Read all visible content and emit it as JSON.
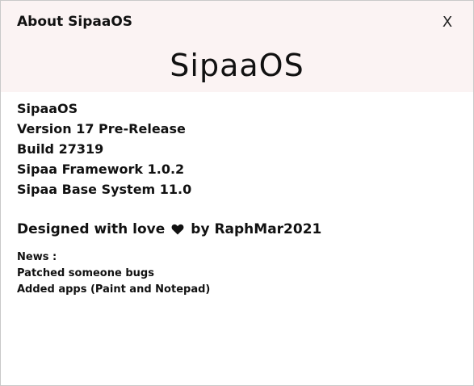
{
  "window": {
    "title": "About SipaaOS",
    "close_label": "X"
  },
  "brand": {
    "name": "SipaaOS"
  },
  "info": {
    "lines": [
      "SipaaOS",
      "Version 17 Pre-Release",
      "Build 27319",
      "Sipaa Framework 1.0.2",
      "Sipaa Base System 11.0"
    ]
  },
  "credits": {
    "prefix": "Designed with love",
    "icon": "heart-icon",
    "suffix": "by RaphMar2021"
  },
  "news": {
    "heading": "News :",
    "items": [
      "Patched someone bugs",
      "Added apps (Paint and Notepad)"
    ]
  }
}
